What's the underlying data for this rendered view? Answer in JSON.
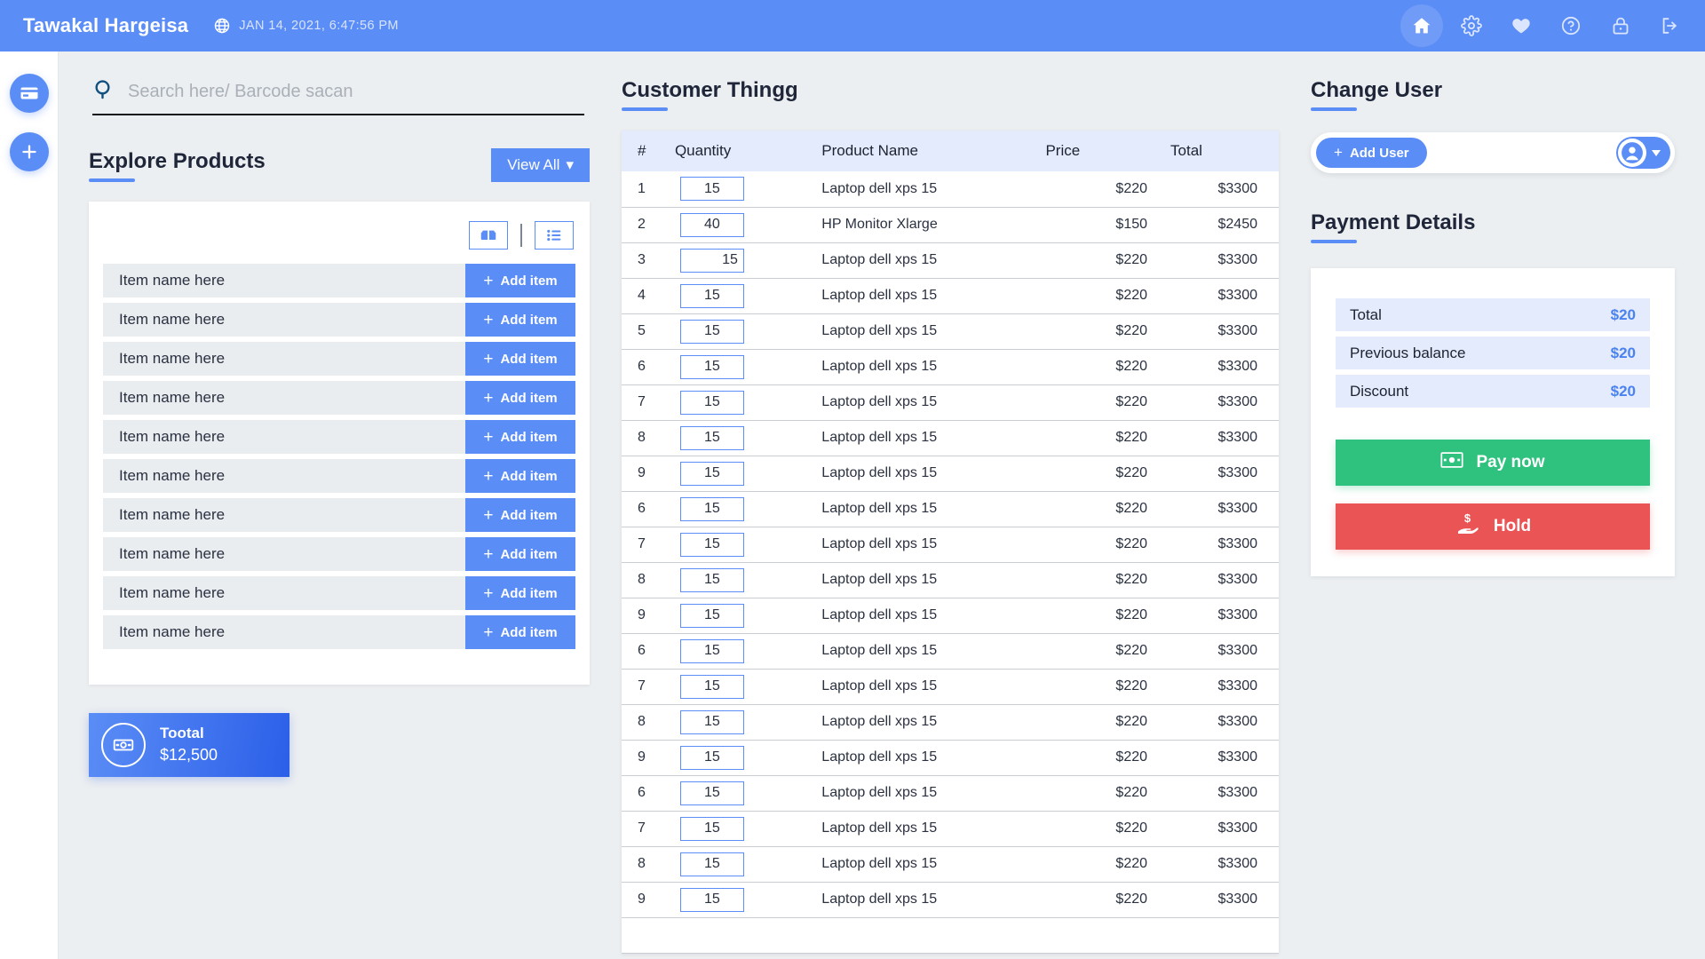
{
  "header": {
    "brand": "Tawakal Hargeisa",
    "globe_icon": "globe-icon",
    "datetime": "JAN 14, 2021, 6:47:56 PM",
    "icons": [
      {
        "name": "home-icon",
        "label": "Home",
        "active": true
      },
      {
        "name": "gear-icon",
        "label": "Settings",
        "active": false
      },
      {
        "name": "heart-icon",
        "label": "Favorites",
        "active": false
      },
      {
        "name": "help-circle-icon",
        "label": "Help",
        "active": false
      },
      {
        "name": "lock-icon",
        "label": "Lock",
        "active": false
      },
      {
        "name": "logout-icon",
        "label": "Logout",
        "active": false
      }
    ]
  },
  "rail": {
    "items": [
      {
        "name": "card-icon",
        "label": "Payments"
      },
      {
        "name": "plus-icon",
        "label": "Add"
      }
    ]
  },
  "search": {
    "placeholder": "Search here/ Barcode sacan",
    "value": "",
    "icon": "search-icon"
  },
  "products": {
    "title": "Explore Products",
    "view_all_label": "View All",
    "view_all_caret": "▾",
    "view_toggles": [
      {
        "name": "grid-view-icon",
        "active": true
      },
      {
        "name": "list-view-icon",
        "active": false
      }
    ],
    "add_label": "Add item",
    "add_plus": "+",
    "items": [
      {
        "name": "Item name here"
      },
      {
        "name": "Item name here"
      },
      {
        "name": "Item name here"
      },
      {
        "name": "Item name here"
      },
      {
        "name": "Item name here"
      },
      {
        "name": "Item name here"
      },
      {
        "name": "Item name here"
      },
      {
        "name": "Item name here"
      },
      {
        "name": "Item name here"
      },
      {
        "name": "Item name here"
      }
    ],
    "total_card": {
      "icon": "money-icon",
      "label": "Tootal",
      "amount": "$12,500"
    }
  },
  "cart": {
    "title": "Customer Thingg",
    "columns": [
      "#",
      "Quantity",
      "Product Name",
      "Price",
      "Total"
    ],
    "rows": [
      {
        "num": "1",
        "qty": "15",
        "product": "Laptop dell xps 15",
        "price": "$220",
        "total": "$3300",
        "qty_align": "center"
      },
      {
        "num": "2",
        "qty": "40",
        "product": "HP Monitor Xlarge",
        "price": "$150",
        "total": "$2450",
        "qty_align": "center"
      },
      {
        "num": "3",
        "qty": "15",
        "product": "Laptop dell xps 15",
        "price": "$220",
        "total": "$3300",
        "qty_align": "right"
      },
      {
        "num": "4",
        "qty": "15",
        "product": "Laptop dell xps 15",
        "price": "$220",
        "total": "$3300",
        "qty_align": "center"
      },
      {
        "num": "5",
        "qty": "15",
        "product": "Laptop dell xps 15",
        "price": "$220",
        "total": "$3300",
        "qty_align": "center"
      },
      {
        "num": "6",
        "qty": "15",
        "product": "Laptop dell xps 15",
        "price": "$220",
        "total": "$3300",
        "qty_align": "center"
      },
      {
        "num": "7",
        "qty": "15",
        "product": "Laptop dell xps 15",
        "price": "$220",
        "total": "$3300",
        "qty_align": "center"
      },
      {
        "num": "8",
        "qty": "15",
        "product": "Laptop dell xps 15",
        "price": "$220",
        "total": "$3300",
        "qty_align": "center"
      },
      {
        "num": "9",
        "qty": "15",
        "product": "Laptop dell xps 15",
        "price": "$220",
        "total": "$3300",
        "qty_align": "center"
      },
      {
        "num": "6",
        "qty": "15",
        "product": "Laptop dell xps 15",
        "price": "$220",
        "total": "$3300",
        "qty_align": "center"
      },
      {
        "num": "7",
        "qty": "15",
        "product": "Laptop dell xps 15",
        "price": "$220",
        "total": "$3300",
        "qty_align": "center"
      },
      {
        "num": "8",
        "qty": "15",
        "product": "Laptop dell xps 15",
        "price": "$220",
        "total": "$3300",
        "qty_align": "center"
      },
      {
        "num": "9",
        "qty": "15",
        "product": "Laptop dell xps 15",
        "price": "$220",
        "total": "$3300",
        "qty_align": "center"
      },
      {
        "num": "6",
        "qty": "15",
        "product": "Laptop dell xps 15",
        "price": "$220",
        "total": "$3300",
        "qty_align": "center"
      },
      {
        "num": "7",
        "qty": "15",
        "product": "Laptop dell xps 15",
        "price": "$220",
        "total": "$3300",
        "qty_align": "center"
      },
      {
        "num": "8",
        "qty": "15",
        "product": "Laptop dell xps 15",
        "price": "$220",
        "total": "$3300",
        "qty_align": "center"
      },
      {
        "num": "9",
        "qty": "15",
        "product": "Laptop dell xps 15",
        "price": "$220",
        "total": "$3300",
        "qty_align": "center"
      },
      {
        "num": "6",
        "qty": "15",
        "product": "Laptop dell xps 15",
        "price": "$220",
        "total": "$3300",
        "qty_align": "center"
      },
      {
        "num": "7",
        "qty": "15",
        "product": "Laptop dell xps 15",
        "price": "$220",
        "total": "$3300",
        "qty_align": "center"
      },
      {
        "num": "8",
        "qty": "15",
        "product": "Laptop dell xps 15",
        "price": "$220",
        "total": "$3300",
        "qty_align": "center"
      },
      {
        "num": "9",
        "qty": "15",
        "product": "Laptop dell xps 15",
        "price": "$220",
        "total": "$3300",
        "qty_align": "center"
      }
    ]
  },
  "change_user": {
    "title": "Change User",
    "add_user_label": "Add User",
    "add_user_plus": "+",
    "avatar_icon": "user-avatar-icon",
    "caret": "▾"
  },
  "payment": {
    "title": "Payment Details",
    "rows": [
      {
        "label": "Total",
        "value": "$20"
      },
      {
        "label": "Previous balance",
        "value": "$20"
      },
      {
        "label": "Discount",
        "value": "$20"
      }
    ],
    "pay_button": {
      "label": "Pay now",
      "icon": "money-icon",
      "color": "#2ec27e"
    },
    "hold_button": {
      "label": "Hold",
      "icon": "hand-money-icon",
      "color": "#ea5454"
    }
  },
  "theme": {
    "accent": "#5b8df6",
    "background": "#eceff1",
    "header_row": "#e4ebfd",
    "success": "#2ec27e",
    "danger": "#ea5454"
  }
}
